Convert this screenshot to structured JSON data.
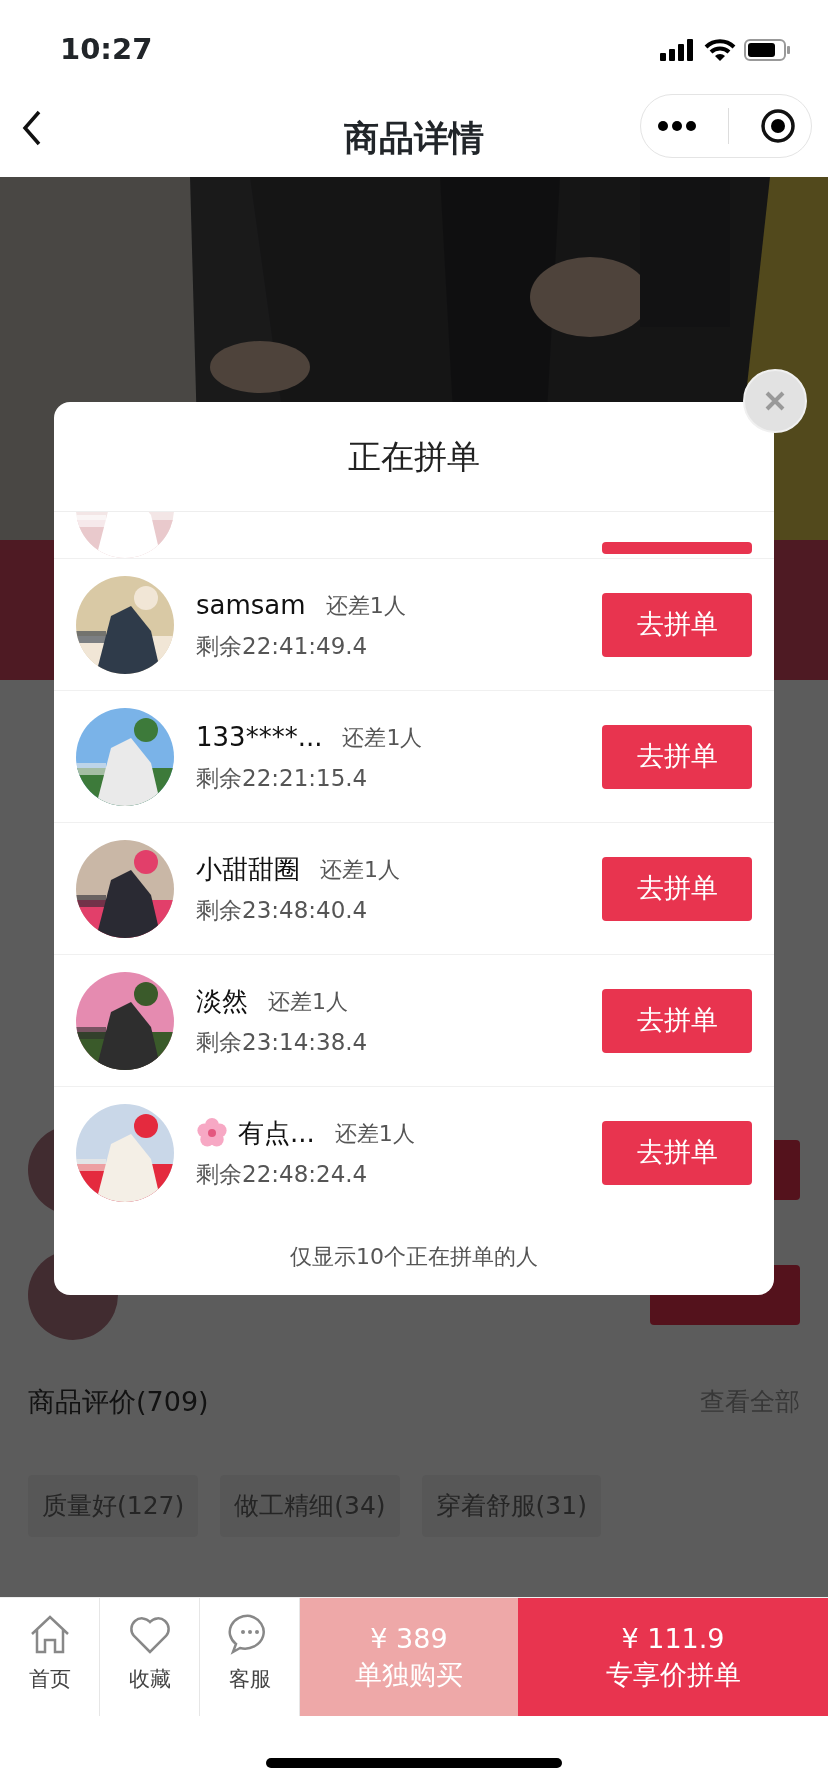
{
  "status_bar": {
    "time": "10:27"
  },
  "nav": {
    "title": "商品详情"
  },
  "reviews": {
    "title": "商品评价(709)",
    "link": "查看全部",
    "tags": [
      "质量好(127)",
      "做工精细(34)",
      "穿着舒服(31)"
    ]
  },
  "popup": {
    "title": "正在拼单",
    "rows": [
      {
        "name": "samsam",
        "flower_icon": false,
        "need": "还差1人",
        "remaining": "剩余22:41:49.4",
        "button": "去拼单"
      },
      {
        "name": "133****...",
        "flower_icon": false,
        "need": "还差1人",
        "remaining": "剩余22:21:15.4",
        "button": "去拼单"
      },
      {
        "name": "小甜甜圈",
        "flower_icon": false,
        "need": "还差1人",
        "remaining": "剩余23:48:40.4",
        "button": "去拼单"
      },
      {
        "name": "淡然",
        "flower_icon": false,
        "need": "还差1人",
        "remaining": "剩余23:14:38.4",
        "button": "去拼单"
      },
      {
        "name": "有点...",
        "flower_icon": true,
        "need": "还差1人",
        "remaining": "剩余22:48:24.4",
        "button": "去拼单"
      }
    ],
    "footer": "仅显示10个正在拼单的人"
  },
  "bottom_bar": {
    "tabs": [
      {
        "kind": "home",
        "label": "首页"
      },
      {
        "kind": "favorite",
        "label": "收藏"
      },
      {
        "kind": "service",
        "label": "客服"
      }
    ],
    "buy_alone": {
      "price": "¥ 389",
      "label": "单独购买"
    },
    "group_buy": {
      "price": "¥ 111.9",
      "label": "专享价拼单"
    }
  }
}
